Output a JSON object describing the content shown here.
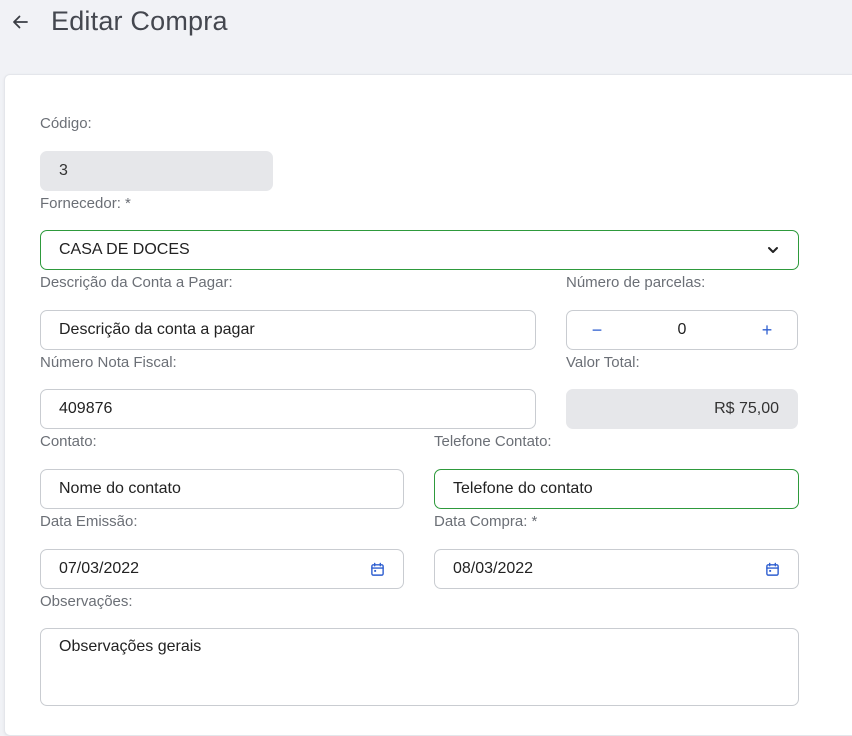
{
  "header": {
    "title": "Editar Compra",
    "back_icon": "arrow-left-icon"
  },
  "form": {
    "codigo": {
      "label": "Código:",
      "value": "3"
    },
    "fornecedor": {
      "label": "Fornecedor: *",
      "value": "CASA DE DOCES"
    },
    "descricao": {
      "label": "Descrição da Conta a Pagar:",
      "value": "Descrição da conta a pagar"
    },
    "parcelas": {
      "label": "Número de parcelas:",
      "value": "0",
      "minus": "−",
      "plus": "+"
    },
    "nota_fiscal": {
      "label": "Número Nota Fiscal:",
      "value": "409876"
    },
    "valor_total": {
      "label": "Valor Total:",
      "value": "R$ 75,00"
    },
    "contato": {
      "label": "Contato:",
      "value": "Nome do contato"
    },
    "telefone": {
      "label": "Telefone Contato:",
      "value": "Telefone do contato"
    },
    "data_emissao": {
      "label": "Data Emissão:",
      "value": "07/03/2022"
    },
    "data_compra": {
      "label": "Data Compra: *",
      "value": "08/03/2022"
    },
    "observacoes": {
      "label": "Observações:",
      "value": "Observações gerais"
    }
  },
  "colors": {
    "accent_green": "#2e9a3c",
    "accent_blue": "#2f5fd0",
    "page_bg": "#f1f2f6"
  }
}
